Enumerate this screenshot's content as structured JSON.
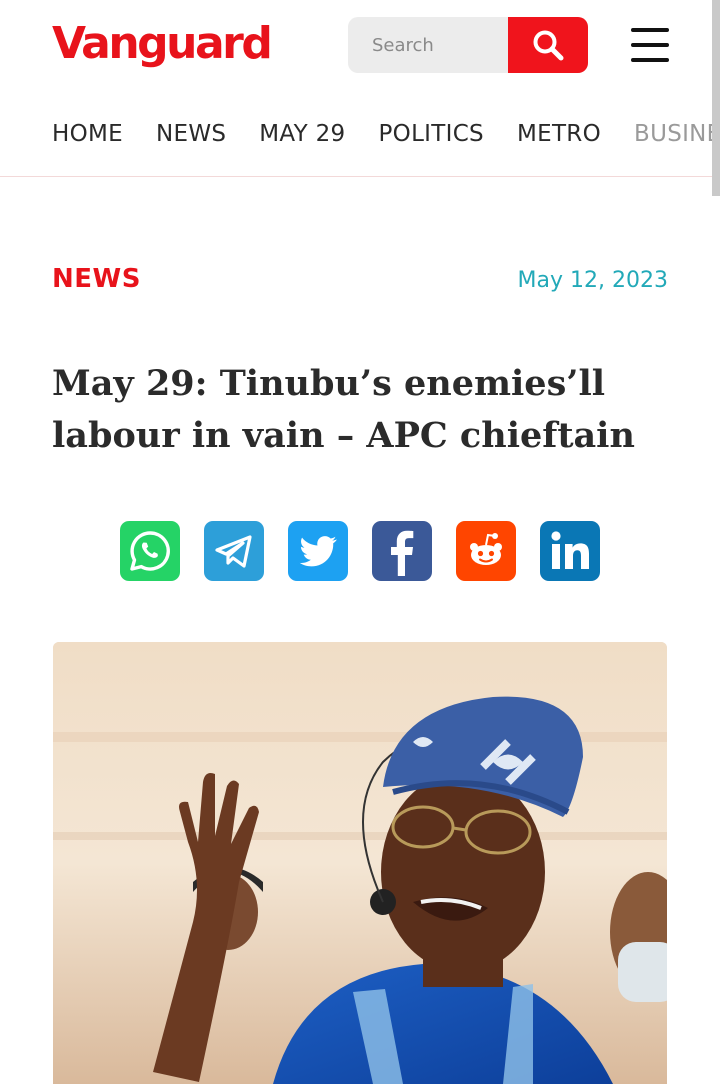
{
  "header": {
    "logo": "Vanguard",
    "search_placeholder": "Search"
  },
  "nav": {
    "items": [
      "HOME",
      "NEWS",
      "MAY 29",
      "POLITICS",
      "METRO",
      "BUSINESS"
    ]
  },
  "article": {
    "category": "NEWS",
    "date": "May 12, 2023",
    "title": "May 29: Tinubu’s enemies’ll labour in vain – APC chieftain"
  },
  "share": [
    {
      "name": "whatsapp",
      "color": "#25d366",
      "icon": "whatsapp-icon"
    },
    {
      "name": "telegram",
      "color": "#2d9fd9",
      "icon": "telegram-icon"
    },
    {
      "name": "twitter",
      "color": "#1da1f2",
      "icon": "twitter-icon"
    },
    {
      "name": "facebook",
      "color": "#3b5998",
      "icon": "facebook-icon"
    },
    {
      "name": "reddit",
      "color": "#ff4500",
      "icon": "reddit-icon"
    },
    {
      "name": "linkedin",
      "color": "#0a77b5",
      "icon": "linkedin-icon"
    }
  ],
  "colors": {
    "brand_red": "#e8131b",
    "date_teal": "#22a9b8"
  }
}
